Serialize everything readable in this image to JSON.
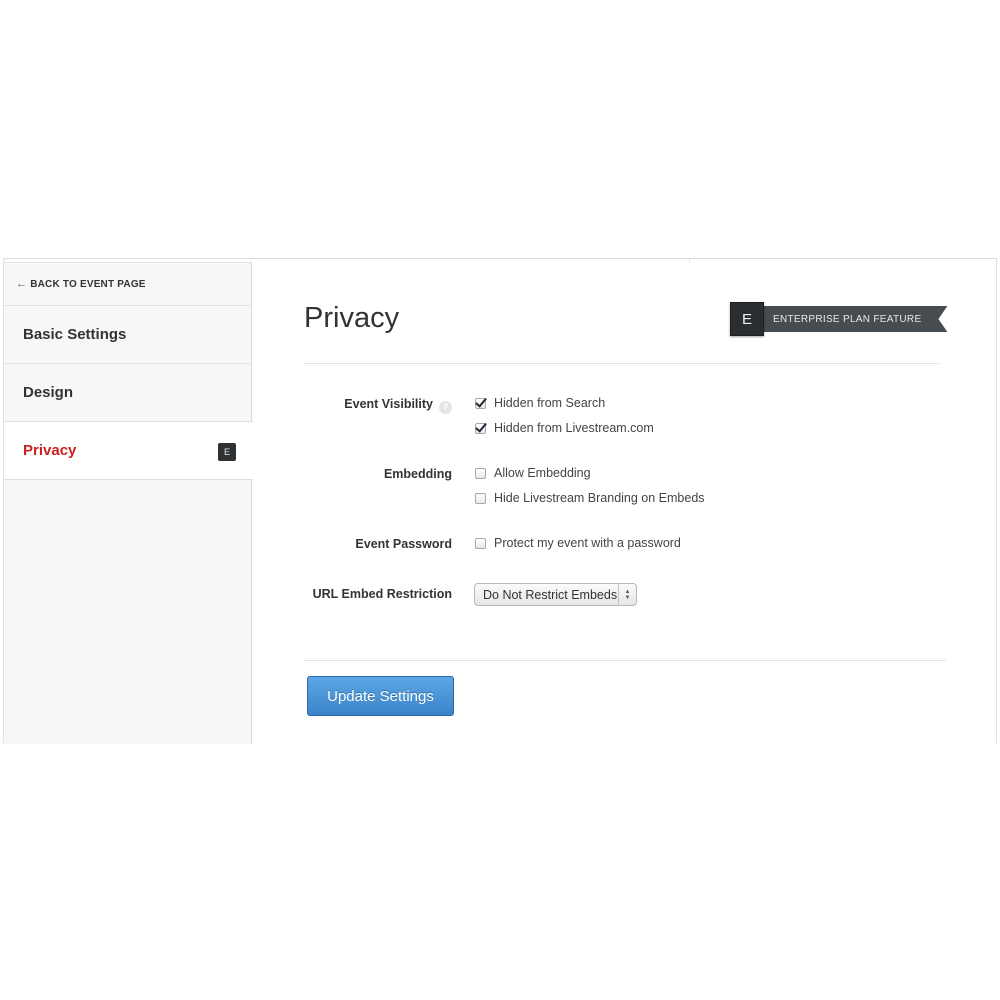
{
  "sidebar": {
    "back_link": "BACK TO EVENT PAGE",
    "items": [
      {
        "label": "Basic Settings"
      },
      {
        "label": "Design"
      },
      {
        "label": "Privacy",
        "badge": "E"
      }
    ]
  },
  "main": {
    "title": "Privacy",
    "enterprise_badge": {
      "letter": "E",
      "text": "ENTERPRISE PLAN FEATURE"
    },
    "event_visibility": {
      "label": "Event Visibility",
      "help": "?",
      "options": [
        {
          "label": "Hidden from Search",
          "checked": true
        },
        {
          "label": "Hidden from Livestream.com",
          "checked": true
        }
      ]
    },
    "embedding": {
      "label": "Embedding",
      "options": [
        {
          "label": "Allow Embedding",
          "checked": false
        },
        {
          "label": "Hide Livestream Branding on Embeds",
          "checked": false
        }
      ]
    },
    "event_password": {
      "label": "Event Password",
      "option": {
        "label": "Protect my event with a password",
        "checked": false
      }
    },
    "url_embed_restriction": {
      "label": "URL Embed Restriction",
      "selected": "Do Not Restrict Embeds"
    },
    "update_button": "Update Settings"
  },
  "colors": {
    "active_nav": "#cc1f1f",
    "primary_button": "#3b84c9",
    "badge_dark": "#2b2e31"
  }
}
